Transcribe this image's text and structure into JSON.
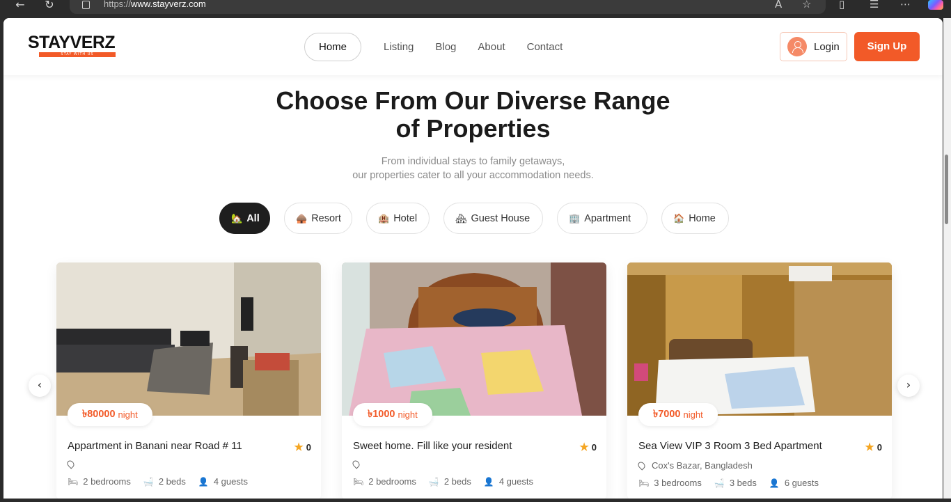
{
  "browser": {
    "url_prefix": "https://",
    "url_domain": "www.stayverz.com"
  },
  "brand": {
    "name": "STAYVERZ",
    "tagline": "STAY WITH US"
  },
  "nav": {
    "items": [
      {
        "label": "Home"
      },
      {
        "label": "Listing"
      },
      {
        "label": "Blog"
      },
      {
        "label": "About"
      },
      {
        "label": "Contact"
      }
    ]
  },
  "auth": {
    "login": "Login",
    "signup": "Sign Up"
  },
  "hero": {
    "title_line1": "Choose From Our Diverse Range",
    "title_line2": "of Properties",
    "subtitle_line1": "From individual stays to family getaways,",
    "subtitle_line2": "our properties cater to all your accommodation needs."
  },
  "filters": [
    {
      "label": "All",
      "icon": "🏡"
    },
    {
      "label": "Resort",
      "icon": "🛖"
    },
    {
      "label": "Hotel",
      "icon": "🏨"
    },
    {
      "label": "Guest House",
      "icon": "🏘"
    },
    {
      "label": "Apartment",
      "icon": "🏢"
    },
    {
      "label": "Home",
      "icon": "🏠"
    }
  ],
  "listings": [
    {
      "price": "৳80000",
      "unit": "night",
      "title": "Appartment in Banani near Road # 11",
      "rating": "0",
      "location": "",
      "bedrooms": "2 bedrooms",
      "beds": "2 beds",
      "guests": "4 guests"
    },
    {
      "price": "৳1000",
      "unit": "night",
      "title": "Sweet home. Fill like your resident",
      "rating": "0",
      "location": "",
      "bedrooms": "2 bedrooms",
      "beds": "2 beds",
      "guests": "4 guests"
    },
    {
      "price": "৳7000",
      "unit": "night",
      "title": "Sea View VIP 3 Room 3 Bed Apartment",
      "rating": "0",
      "location": "Cox's Bazar, Bangladesh",
      "bedrooms": "3 bedrooms",
      "beds": "3 beds",
      "guests": "6 guests"
    }
  ],
  "colors": {
    "brand": "#f25a28",
    "star": "#f5a623"
  }
}
